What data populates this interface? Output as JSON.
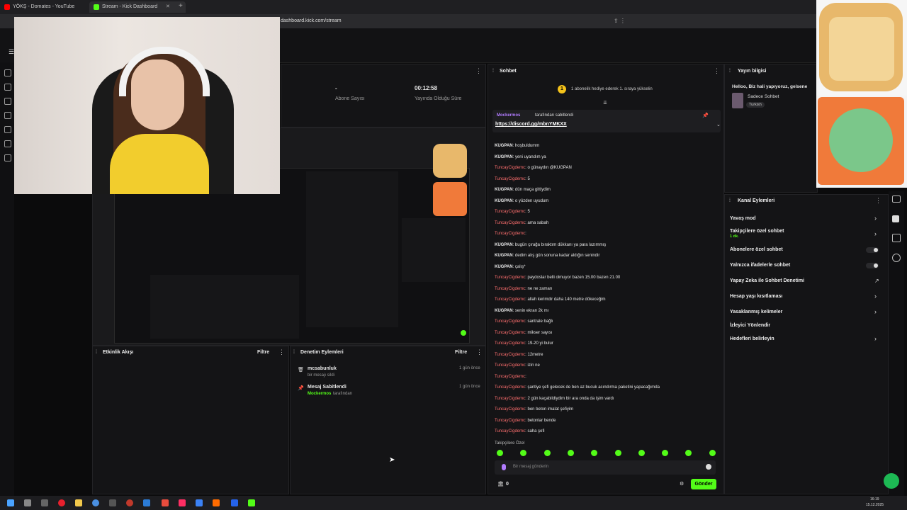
{
  "browser": {
    "tabs": [
      {
        "label": "YÖKŞ - Domates - YouTube"
      },
      {
        "label": "Stream - Kick Dashboard"
      }
    ],
    "url": "dashboard.kick.com/stream"
  },
  "stats": {
    "subs_value": "-",
    "subs_label": "Abone Sayısı",
    "time_value": "00:12:58",
    "time_label": "Yayında Olduğu Süre"
  },
  "chat": {
    "title": "Sohbet",
    "goal": "1 abonelik hediye ederek 1. sıraya yükselin",
    "pinned_by": "Mockermos",
    "pinned_suffix": "tarafından sabitlendi",
    "pinned_link": "https://discord.gg/mbnYMKXX",
    "messages": [
      {
        "user": "KUGPAN",
        "text": "hoşbuldumm",
        "kind": "k"
      },
      {
        "user": "KUGPAN",
        "text": "yeni uyandım ya",
        "kind": "k"
      },
      {
        "user": "TuncayCigdemc",
        "text": "o günaydın @KUGPAN",
        "kind": "t"
      },
      {
        "user": "TuncayCigdemc",
        "text": "5",
        "kind": "t"
      },
      {
        "user": "KUGPAN",
        "text": "dün maça gittiydim",
        "kind": "k"
      },
      {
        "user": "KUGPAN",
        "text": "o yüzden uyudum",
        "kind": "k"
      },
      {
        "user": "TuncayCigdemc",
        "text": "5",
        "kind": "t"
      },
      {
        "user": "TuncayCigdemc",
        "text": "ama sabah",
        "kind": "t"
      },
      {
        "user": "TuncayCigdemc",
        "text": "",
        "kind": "t"
      },
      {
        "user": "KUGPAN",
        "text": "bugün çırağa bıraktım dükkanı ya para lazımmış",
        "kind": "k"
      },
      {
        "user": "KUGPAN",
        "text": "dedim alış gün sonuna kadar aldığın senindir",
        "kind": "k"
      },
      {
        "user": "KUGPAN",
        "text": "çalış*",
        "kind": "k"
      },
      {
        "user": "TuncayCigdemc",
        "text": "paydoslar belli olmuyor bazen 15.00 bazen 21.00",
        "kind": "t"
      },
      {
        "user": "TuncayCigdemc",
        "text": "ne ne zaman",
        "kind": "t"
      },
      {
        "user": "TuncayCigdemc",
        "text": "allah kerimdir daha 140 metre dökeceğim",
        "kind": "t"
      },
      {
        "user": "KUGPAN",
        "text": "senin ekran 2k mı",
        "kind": "k"
      },
      {
        "user": "TuncayCigdemc",
        "text": "santrale bağlı",
        "kind": "t"
      },
      {
        "user": "TuncayCigdemc",
        "text": "mikser sayısı",
        "kind": "t"
      },
      {
        "user": "TuncayCigdemc",
        "text": "19-20 yi bulur",
        "kind": "t"
      },
      {
        "user": "TuncayCigdemc",
        "text": "12metre",
        "kind": "t"
      },
      {
        "user": "TuncayCigdemc",
        "text": "izin ne",
        "kind": "t"
      },
      {
        "user": "TuncayCigdemc",
        "text": "",
        "kind": "t"
      },
      {
        "user": "TuncayCigdemc",
        "text": "şantiye şefi gelecek de ben az bucuk acındırma paketini yapacağımda",
        "kind": "t"
      },
      {
        "user": "TuncayCigdemc",
        "text": "2 gün kaçabildiydim bir ara onda da işim vardı",
        "kind": "t"
      },
      {
        "user": "TuncayCigdemc",
        "text": "ben beton imalat şefiyim",
        "kind": "t"
      },
      {
        "user": "TuncayCigdemc",
        "text": "betonlar bende",
        "kind": "t"
      },
      {
        "user": "TuncayCigdemc",
        "text": "saha şefi",
        "kind": "t"
      }
    ],
    "followers_only": "Takipçilere Özel",
    "input_placeholder": "Bir mesaj gönderin",
    "count": "0",
    "send_label": "Gönder"
  },
  "stream_info": {
    "title": "Yayın bilgisi",
    "stream_title": "Helloo, Biz hali yapıyoruz, gelsene",
    "category": "Sadece Sohbet",
    "language": "Turkish"
  },
  "activity": {
    "title": "Etkinlik Akışı",
    "filter": "Filtre"
  },
  "moderation": {
    "title": "Denetim Eylemleri",
    "filter": "Filtre",
    "items": [
      {
        "user": "mcsabunluk",
        "desc": "bir mesajı sildi",
        "time": "1 gün önce"
      },
      {
        "user": "Mesaj Sabitlendi",
        "by": "Mockermos",
        "desc": "tarafından",
        "time": "1 gün önce"
      }
    ]
  },
  "channel_actions": {
    "title": "Kanal Eylemleri",
    "items": [
      {
        "label": "Yavaş mod",
        "control": "chevron"
      },
      {
        "label": "Takipçilere özel sohbet",
        "sub": "1 dk.",
        "control": "chevron"
      },
      {
        "label": "Abonelere özel sohbet",
        "control": "toggle"
      },
      {
        "label": "Yalnızca ifadelerle sohbet",
        "control": "toggle"
      },
      {
        "label": "Yapay Zeka ile Sohbet Denetimi",
        "control": "link"
      },
      {
        "label": "Hesap yaşı kısıtlaması",
        "control": "chevron"
      },
      {
        "label": "Yasaklanmış kelimeler",
        "control": "chevron"
      },
      {
        "label": "İzleyici Yönlendir",
        "control": "none"
      },
      {
        "label": "Hedefleri belirleyin",
        "control": "chevron"
      }
    ]
  },
  "taskbar": {
    "time": "16:19",
    "date": "15.12.2025"
  },
  "colors": {
    "accent": "#53fc18",
    "user_t": "#ff6f6f",
    "bg": "#0b0b0c"
  }
}
